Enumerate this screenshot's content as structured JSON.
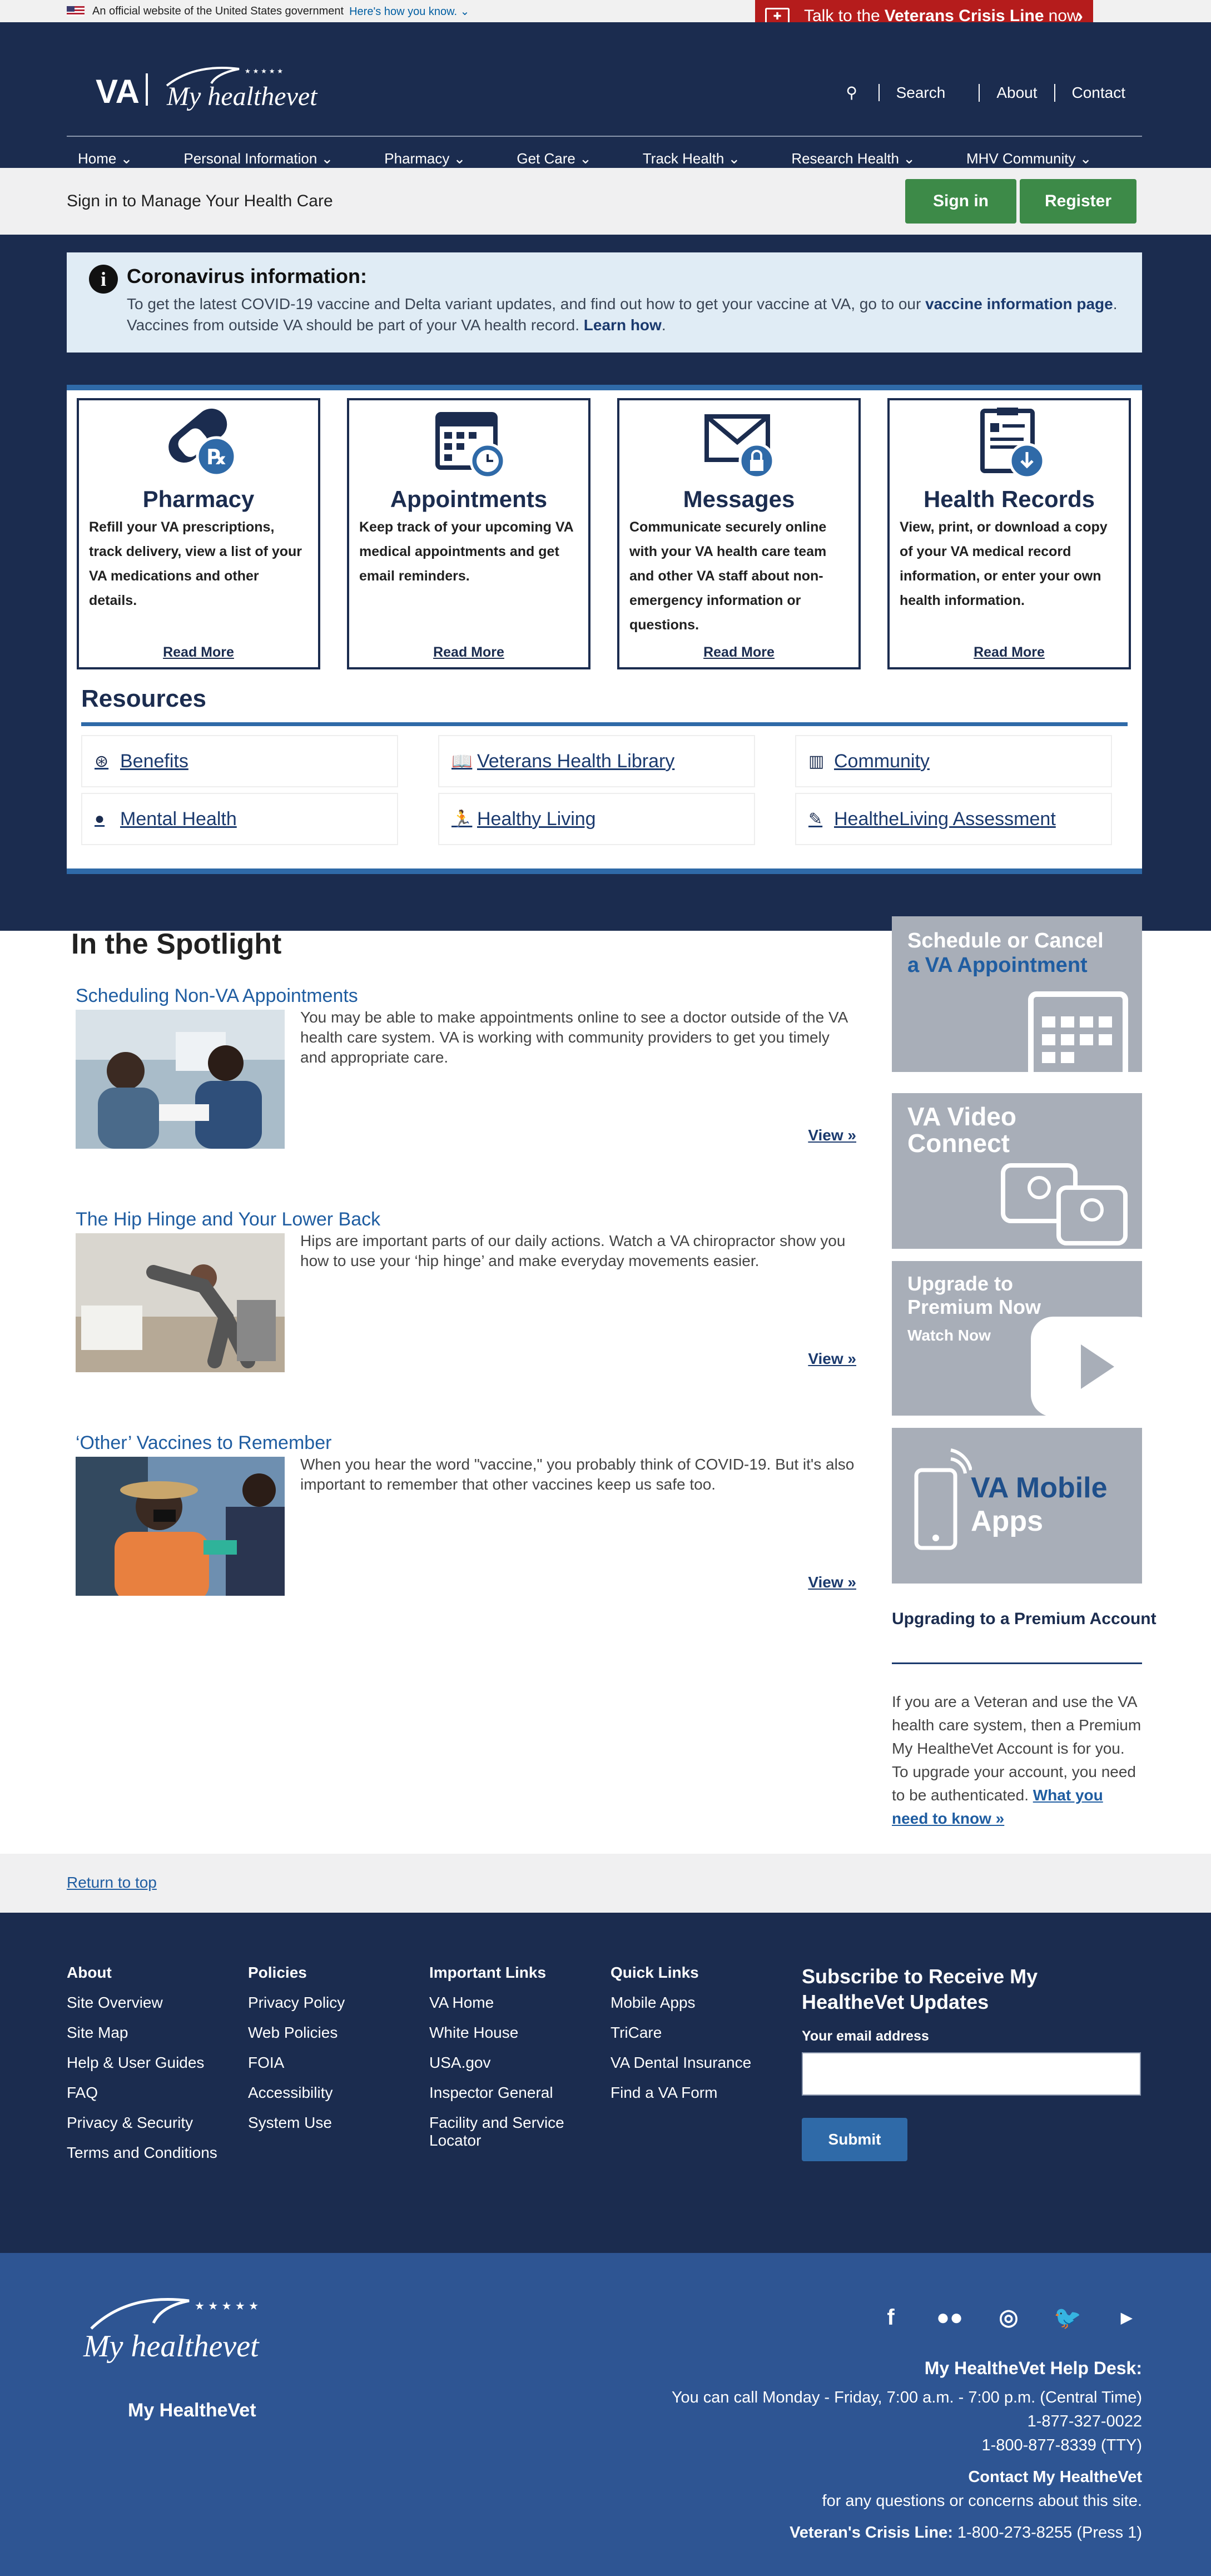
{
  "gov_banner": {
    "text": "An official website of the United States government",
    "link": "Here's how you know."
  },
  "crisis": {
    "prefix": "Talk to the",
    "bold": "Veterans Crisis Line",
    "suffix": "now"
  },
  "header": {
    "logo_va": "VA",
    "logo_mhv": "My healthevet",
    "utility": [
      "Search",
      "About",
      "Contact"
    ],
    "nav": [
      "Home",
      "Personal Information",
      "Pharmacy",
      "Get Care",
      "Track Health",
      "Research Health",
      "MHV Community"
    ]
  },
  "signin_bar": {
    "text": "Sign in to Manage Your Health Care",
    "sign_in": "Sign in",
    "register": "Register"
  },
  "covid": {
    "title": "Coronavirus information:",
    "line1_pre": "To get the latest COVID-19 vaccine and Delta variant updates, and find out how to get your vaccine at VA, go to our ",
    "line1_link": "vaccine information page",
    "line1_post": ".",
    "line2_pre": "Vaccines from outside VA should be part of your VA health record. ",
    "line2_link": "Learn how",
    "line2_post": "."
  },
  "cards": [
    {
      "title": "Pharmacy",
      "text": "Refill your VA prescriptions, track delivery, view a list of your VA medications and other details.",
      "link": "Read More"
    },
    {
      "title": "Appointments",
      "text": "Keep track of your upcoming VA medical appointments and get email reminders.",
      "link": "Read More"
    },
    {
      "title": "Messages",
      "text": "Communicate securely online with your VA health care team and other VA staff about non-emergency information or questions.",
      "link": "Read More"
    },
    {
      "title": "Health Records",
      "text": "View, print, or download a copy of your VA medical record information, or enter your own health information.",
      "link": "Read More"
    }
  ],
  "resources": {
    "title": "Resources",
    "items": [
      "Benefits",
      "Veterans Health Library",
      "Community",
      "Mental Health",
      "Healthy Living",
      "HealtheLiving Assessment"
    ]
  },
  "spotlight": {
    "title": "In the Spotlight",
    "articles": [
      {
        "title": "Scheduling Non-VA Appointments",
        "text": "You may be able to make appointments online to see a doctor outside of the VA health care system. VA is working with community providers to get you timely and appropriate care.",
        "link": "View »"
      },
      {
        "title": "The Hip Hinge and Your Lower Back",
        "text": "Hips are important parts of our daily actions. Watch a VA chiropractor show you how to use your ‘hip hinge’ and make everyday movements easier.",
        "link": "View »"
      },
      {
        "title": "‘Other’ Vaccines to Remember",
        "text": "When you hear the word \"vaccine,\" you probably think of COVID-19. But it's also important to remember that other vaccines keep us safe too.",
        "link": "View »"
      }
    ]
  },
  "promos": {
    "schedule_line1": "Schedule or Cancel",
    "schedule_line2": "a VA Appointment",
    "video_line1": "VA Video",
    "video_line2": "Connect",
    "premium_line1": "Upgrade to",
    "premium_line2": "Premium Now",
    "premium_line3": "Watch Now",
    "mobile_line1": "VA Mobile",
    "mobile_line2": "Apps"
  },
  "upgrade": {
    "title": "Upgrading to a Premium Account",
    "text": "If you are a Veteran and use the VA health care system, then a Premium My HealtheVet Account is for you. To upgrade your account, you need to be authenticated. ",
    "link": "What you need to know »"
  },
  "return_top": "Return to top",
  "footer": {
    "columns": [
      {
        "heading": "About",
        "links": [
          "Site Overview",
          "Site Map",
          "Help & User Guides",
          "FAQ",
          "Privacy & Security",
          "Terms and Conditions"
        ]
      },
      {
        "heading": "Policies",
        "links": [
          "Privacy Policy",
          "Web Policies",
          "FOIA",
          "Accessibility",
          "System Use"
        ]
      },
      {
        "heading": "Important Links",
        "links": [
          "VA Home",
          "White House",
          "USA.gov",
          "Inspector General",
          "Facility and Service Locator"
        ]
      },
      {
        "heading": "Quick Links",
        "links": [
          "Mobile Apps",
          "TriCare",
          "VA Dental Insurance",
          "Find a VA Form"
        ]
      }
    ],
    "subscribe": {
      "heading": "Subscribe to Receive My HealtheVet Updates",
      "label": "Your email address",
      "button": "Submit"
    }
  },
  "bottom": {
    "logo": "My healthevet",
    "name": "My HealtheVet",
    "help_title": "My HealtheVet Help Desk:",
    "hours": "You can call Monday - Friday, 7:00 a.m. - 7:00 p.m. (Central Time)",
    "phone1": "1-877-327-0022",
    "phone2": "1-800-877-8339 (TTY)",
    "contact_title": "Contact My HealtheVet",
    "contact_text": "for any questions or concerns about this site.",
    "crisis_label": "Veteran's Crisis Line:",
    "crisis_phone": " 1-800-273-8255 (Press 1)"
  }
}
